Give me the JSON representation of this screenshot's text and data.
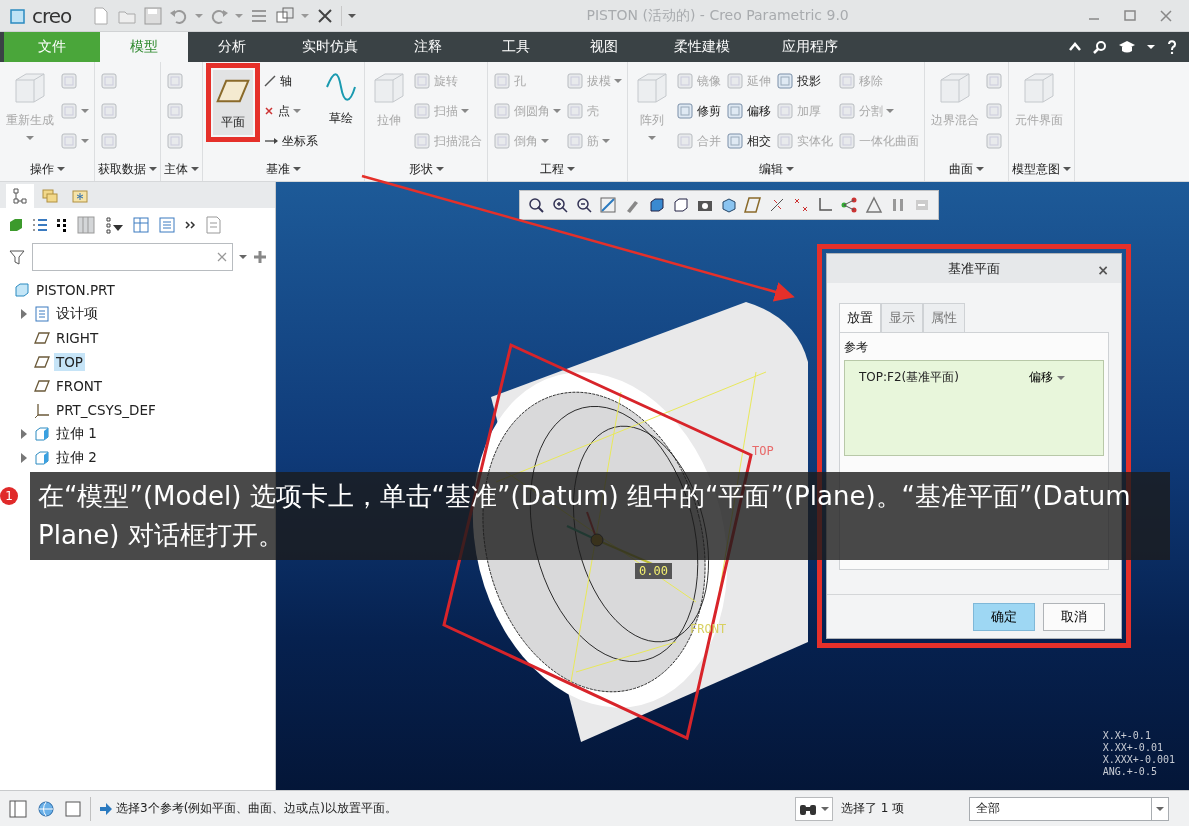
{
  "window": {
    "logo": "creo",
    "title": "PISTON (活动的) - Creo Parametric 9.0"
  },
  "ribbon_tabs": [
    {
      "label": "文件",
      "kind": "file",
      "selected": false
    },
    {
      "label": "模型",
      "kind": "tab",
      "selected": true
    },
    {
      "label": "分析",
      "kind": "tab",
      "selected": false
    },
    {
      "label": "实时仿真",
      "kind": "tab",
      "selected": false
    },
    {
      "label": "注释",
      "kind": "tab",
      "selected": false
    },
    {
      "label": "工具",
      "kind": "tab",
      "selected": false
    },
    {
      "label": "视图",
      "kind": "tab",
      "selected": false
    },
    {
      "label": "柔性建模",
      "kind": "tab",
      "selected": false
    },
    {
      "label": "应用程序",
      "kind": "tab",
      "selected": false
    }
  ],
  "ribbon_groups": [
    {
      "label": "操作",
      "columns": [
        [
          {
            "kind": "large",
            "label": "重新生成",
            "disabled": true,
            "dropdown": true
          }
        ],
        [
          {
            "kind": "small",
            "disabled": true,
            "dropdown": false
          },
          {
            "kind": "small",
            "disabled": true,
            "dropdown": true
          },
          {
            "kind": "small",
            "disabled": true,
            "dropdown": true
          }
        ]
      ]
    },
    {
      "label": "获取数据",
      "columns": [
        [
          {
            "kind": "small",
            "disabled": true,
            "dropdown": false
          },
          {
            "kind": "small",
            "disabled": true,
            "dropdown": false
          },
          {
            "kind": "small",
            "disabled": true,
            "dropdown": false
          }
        ]
      ]
    },
    {
      "label": "主体",
      "columns": [
        [
          {
            "kind": "small",
            "disabled": true,
            "dropdown": false
          },
          {
            "kind": "small",
            "disabled": true,
            "dropdown": false
          },
          {
            "kind": "small",
            "disabled": true,
            "dropdown": false
          }
        ]
      ]
    },
    {
      "label": "基准",
      "columns": [
        [
          {
            "kind": "large",
            "label": "平面",
            "disabled": false,
            "dropdown": false,
            "highlighted": true
          }
        ],
        [
          {
            "kind": "small",
            "label": "轴",
            "disabled": false,
            "dropdown": false
          },
          {
            "kind": "small",
            "label": "点",
            "disabled": false,
            "dropdown": true
          },
          {
            "kind": "small",
            "label": "坐标系",
            "disabled": false,
            "dropdown": false
          }
        ],
        [
          {
            "kind": "large",
            "label": "草绘",
            "disabled": false,
            "dropdown": false
          }
        ]
      ]
    },
    {
      "label": "形状",
      "columns": [
        [
          {
            "kind": "large",
            "label": "拉伸",
            "disabled": true,
            "dropdown": false
          }
        ],
        [
          {
            "kind": "small",
            "label": "旋转",
            "disabled": true,
            "dropdown": false
          },
          {
            "kind": "small",
            "label": "扫描",
            "disabled": true,
            "dropdown": true
          },
          {
            "kind": "small",
            "label": "扫描混合",
            "disabled": true,
            "dropdown": false
          }
        ]
      ]
    },
    {
      "label": "工程",
      "columns": [
        [
          {
            "kind": "small",
            "label": "孔",
            "disabled": true,
            "dropdown": false
          },
          {
            "kind": "small",
            "label": "倒圆角",
            "disabled": true,
            "dropdown": true
          },
          {
            "kind": "small",
            "label": "倒角",
            "disabled": true,
            "dropdown": true
          }
        ],
        [
          {
            "kind": "small",
            "label": "拔模",
            "disabled": true,
            "dropdown": true
          },
          {
            "kind": "small",
            "label": "壳",
            "disabled": true,
            "dropdown": false
          },
          {
            "kind": "small",
            "label": "筋",
            "disabled": true,
            "dropdown": true
          }
        ]
      ]
    },
    {
      "label": "编辑",
      "columns": [
        [
          {
            "kind": "large",
            "label": "阵列",
            "disabled": true,
            "dropdown": true
          }
        ],
        [
          {
            "kind": "small",
            "label": "镜像",
            "disabled": true,
            "dropdown": false
          },
          {
            "kind": "small",
            "label": "修剪",
            "disabled": false,
            "dropdown": false
          },
          {
            "kind": "small",
            "label": "合并",
            "disabled": true,
            "dropdown": false
          }
        ],
        [
          {
            "kind": "small",
            "label": "延伸",
            "disabled": true,
            "dropdown": false
          },
          {
            "kind": "small",
            "label": "偏移",
            "disabled": false,
            "dropdown": false
          },
          {
            "kind": "small",
            "label": "相交",
            "disabled": false,
            "dropdown": false
          }
        ],
        [
          {
            "kind": "small",
            "label": "投影",
            "disabled": false,
            "dropdown": false
          },
          {
            "kind": "small",
            "label": "加厚",
            "disabled": true,
            "dropdown": false
          },
          {
            "kind": "small",
            "label": "实体化",
            "disabled": true,
            "dropdown": false
          }
        ],
        [
          {
            "kind": "small",
            "label": "移除",
            "disabled": true,
            "dropdown": false
          },
          {
            "kind": "small",
            "label": "分割",
            "disabled": true,
            "dropdown": true
          },
          {
            "kind": "small",
            "label": "一体化曲面",
            "disabled": true,
            "dropdown": false
          }
        ]
      ]
    },
    {
      "label": "曲面",
      "columns": [
        [
          {
            "kind": "large",
            "label": "边界混合",
            "disabled": true,
            "dropdown": false
          }
        ],
        [
          {
            "kind": "small",
            "disabled": true,
            "dropdown": false
          },
          {
            "kind": "small",
            "disabled": true,
            "dropdown": false
          },
          {
            "kind": "small",
            "disabled": true,
            "dropdown": false
          }
        ]
      ]
    },
    {
      "label": "模型意图",
      "columns": [
        [
          {
            "kind": "large",
            "label": "元件界面",
            "disabled": true,
            "dropdown": false
          }
        ]
      ]
    }
  ],
  "panel_tabs": [
    {
      "selected": true
    },
    {
      "selected": false
    },
    {
      "selected": false
    }
  ],
  "tree": [
    {
      "label": "PISTON.PRT",
      "kind": "part",
      "selected": false,
      "children": [
        {
          "label": "设计项",
          "kind": "group",
          "selected": false,
          "expanded": false
        },
        {
          "label": "RIGHT",
          "kind": "plane",
          "selected": false
        },
        {
          "label": "TOP",
          "kind": "plane",
          "selected": true
        },
        {
          "label": "FRONT",
          "kind": "plane",
          "selected": false
        },
        {
          "label": "PRT_CSYS_DEF",
          "kind": "csys",
          "selected": false
        },
        {
          "label": "拉伸 1",
          "kind": "feature",
          "selected": false,
          "expanded": false
        },
        {
          "label": "拉伸 2",
          "kind": "feature",
          "selected": false,
          "expanded": false
        }
      ]
    }
  ],
  "viewport": {
    "labels": [
      {
        "text": "TOP",
        "kind": "plane-tag"
      },
      {
        "text": "FRONT",
        "kind": "plane-tag-front"
      },
      {
        "text": "0.00",
        "kind": "dimension"
      }
    ],
    "tolerances": [
      "X.X+-0.1",
      "X.XX+-0.01",
      "X.XXX+-0.001",
      "ANG.+-0.5"
    ]
  },
  "dialog": {
    "title": "基准平面",
    "close": "×",
    "tabs": [
      {
        "label": "放置",
        "selected": true
      },
      {
        "label": "显示",
        "selected": false
      },
      {
        "label": "属性",
        "selected": false
      }
    ],
    "references_label": "参考",
    "references": [
      {
        "name": "TOP:F2(基准平面)",
        "constraint": "偏移"
      }
    ],
    "buttons": [
      {
        "label": "确定",
        "kind": "primary"
      },
      {
        "label": "取消",
        "kind": "normal"
      }
    ],
    "highlighted": true
  },
  "caption": {
    "number": "1",
    "text": "在“模型”(Model) 选项卡上，单击“基准”(Datum) 组中的“平面”(Plane)。“基准平面”(Datum Plane) 对话框打开。"
  },
  "status_bar": {
    "message": "选择3个参考(例如平面、曲面、边或点)以放置平面。",
    "selection": "选择了 1 项",
    "filter": "全部"
  }
}
